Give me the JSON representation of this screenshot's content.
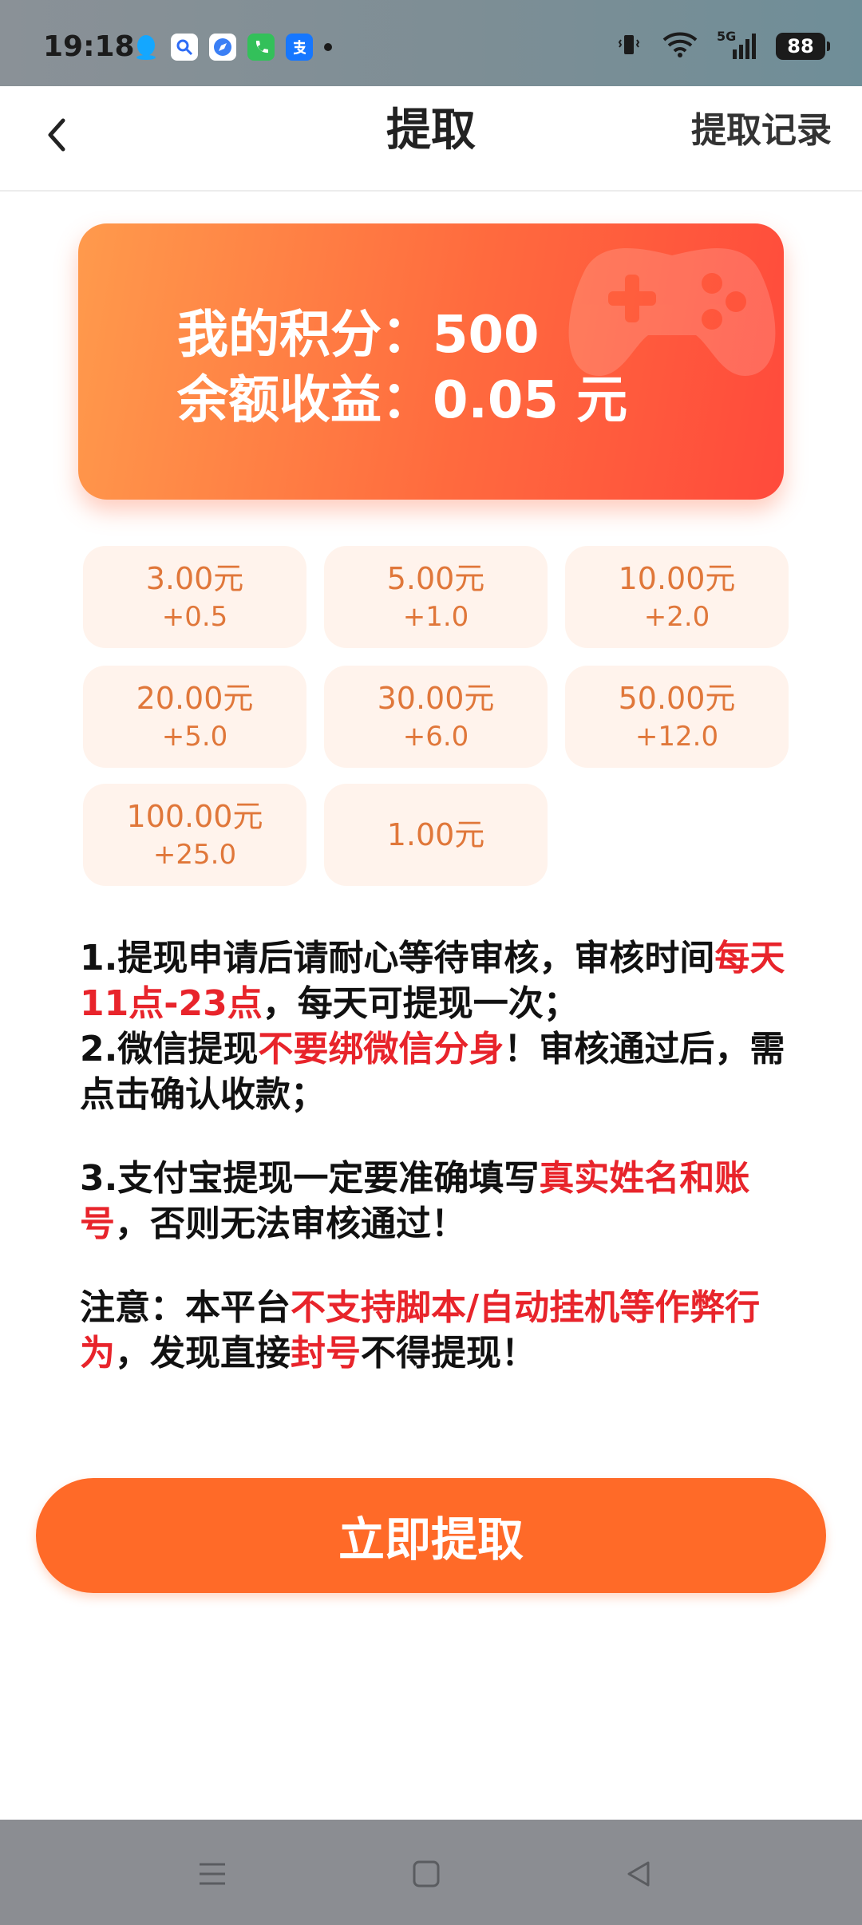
{
  "status_bar": {
    "time": "19:18",
    "battery": "88",
    "signal_label": "5G",
    "apps": [
      "qq-icon",
      "search-app-icon",
      "browser-icon",
      "phone-icon",
      "alipay-icon"
    ]
  },
  "header": {
    "title": "提取",
    "back_icon": "chevron-left-icon",
    "records_label": "提取记录"
  },
  "balance": {
    "points_label": "我的积分：500",
    "income_label": "余额收益：0.05 元",
    "decor_icon": "gamepad-icon"
  },
  "amounts": [
    {
      "amount": "3.00元",
      "bonus": "+0.5"
    },
    {
      "amount": "5.00元",
      "bonus": "+1.0"
    },
    {
      "amount": "10.00元",
      "bonus": "+2.0"
    },
    {
      "amount": "20.00元",
      "bonus": "+5.0"
    },
    {
      "amount": "30.00元",
      "bonus": "+6.0"
    },
    {
      "amount": "50.00元",
      "bonus": "+12.0"
    },
    {
      "amount": "100.00元",
      "bonus": "+25.0"
    },
    {
      "amount": "1.00元",
      "bonus": ""
    }
  ],
  "notes": {
    "n1_a": "1.提现申请后请耐心等待审核，审核时间",
    "n1_red": "每天11点-23点",
    "n1_b": "，每天可提现一次；",
    "n2_a": "2.微信提现",
    "n2_red": "不要绑微信分身",
    "n2_b": "！审核通过后，需点击确认收款；",
    "n3_a": "3.支付宝提现一定要准确填写",
    "n3_red": "真实姓名和账号",
    "n3_b": "，否则无法审核通过！",
    "n4_a": "注意：本平台",
    "n4_red1": "不支持脚本/自动挂机等作弊行为",
    "n4_b": "，发现直接",
    "n4_red2": "封号",
    "n4_c": "不得提现！"
  },
  "withdraw_button": "立即提取",
  "colors": {
    "accent": "#ff6a28",
    "card_start": "#ff9a4c",
    "card_end": "#ff4a3c",
    "tile_bg": "#fff3ec",
    "tile_text": "#e0773a",
    "warning_red": "#e8242b"
  },
  "nav_bar": {
    "menu_icon": "menu-icon",
    "home_icon": "home-square-icon",
    "back_icon": "back-triangle-icon"
  }
}
